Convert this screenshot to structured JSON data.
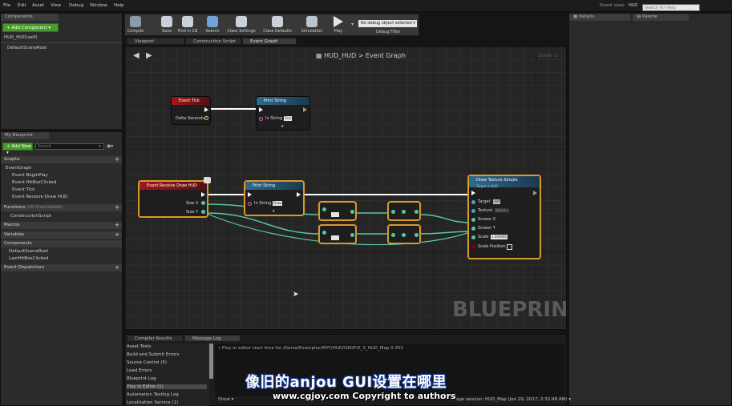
{
  "menu": [
    "File",
    "Edit",
    "Asset",
    "View",
    "Debug",
    "Window",
    "Help"
  ],
  "topright": {
    "parent_label": "Parent class:",
    "parent_value": "HUD",
    "search_placeholder": "Search for Help"
  },
  "components": {
    "header": "Components",
    "add_button": "+ Add Component ▾",
    "root_label": "HUD_HUD(self)",
    "items": [
      "DefaultSceneRoot"
    ]
  },
  "myblueprint": {
    "header": "My Blueprint",
    "add_new": "+ Add New ▾",
    "search_placeholder": "Search",
    "sections": {
      "graphs": {
        "label": "Graphs",
        "items": [
          "EventGraph",
          "Event BeginPlay",
          "Event HitBoxClicked",
          "Event Tick",
          "Event Receive Draw HUD"
        ]
      },
      "functions": {
        "label": "Functions",
        "badge": "(26 Overridable)",
        "items": [
          "ConstructionScript"
        ]
      },
      "macros": {
        "label": "Macros"
      },
      "variables": {
        "label": "Variables"
      },
      "components": {
        "label": "Components",
        "items": [
          "DefaultSceneRoot",
          "LastHitBoxClicked"
        ]
      },
      "dispatchers": {
        "label": "Event Dispatchers"
      }
    }
  },
  "toolbar": {
    "buttons": [
      "Compile",
      "Save",
      "Find in CB",
      "Search",
      "Class Settings",
      "Class Defaults",
      "Simulation",
      "Play"
    ],
    "debug_select": "No debug object selected ▾",
    "debug_label": "Debug Filter"
  },
  "tabs": [
    "Viewport",
    "Construction Script",
    "Event Graph"
  ],
  "graph": {
    "breadcrumb": "HUD_HUD",
    "breadcrumb_sep": ">",
    "breadcrumb_current": "Event Graph",
    "zoom": "Zoom -1",
    "watermark": "BLUEPRINT",
    "nodes": {
      "tick": {
        "title": "Event Tick",
        "pin": "Delta Seconds"
      },
      "print1": {
        "title": "Print String",
        "pin": "In String",
        "value": "Tick"
      },
      "draw": {
        "title": "Event Receive Draw HUD",
        "pins": [
          "Size X",
          "Size Y"
        ]
      },
      "print2": {
        "title": "Print String",
        "pin": "In String",
        "value": "Draw"
      },
      "texture": {
        "title": "Draw Texture Simple",
        "subtitle": "Target is HUD",
        "pins": [
          "Target",
          "Texture",
          "Screen X",
          "Screen Y",
          "Scale",
          "Scale Position"
        ],
        "target_value": "self",
        "texture_value": "Select ▾",
        "scale_value": "1.000000"
      }
    }
  },
  "right": {
    "details": "Details",
    "palette": "Palette"
  },
  "bottom": {
    "tabs": [
      "Compiler Results",
      "Message Log"
    ],
    "categories": [
      "Asset Tools",
      "Build and Submit Errors",
      "Source Control (5)",
      "Load Errors",
      "Blueprint Log",
      "Play in Editor (1)",
      "Automation Testing Log",
      "Localization Service (1)"
    ],
    "log_line": "Play in editor start time for /Game/Examples/MYF/HUD/GEOFIX_3_HUD_Map 0.352",
    "show": "Show ▾",
    "session": "Page session: HUD_Map (Jan 29, 2017, 2:32:48 AM) ▾"
  },
  "subtitle": "像旧的anjou GUI设置在哪里",
  "copyright": "www.cgjoy.com Copyright to authors"
}
